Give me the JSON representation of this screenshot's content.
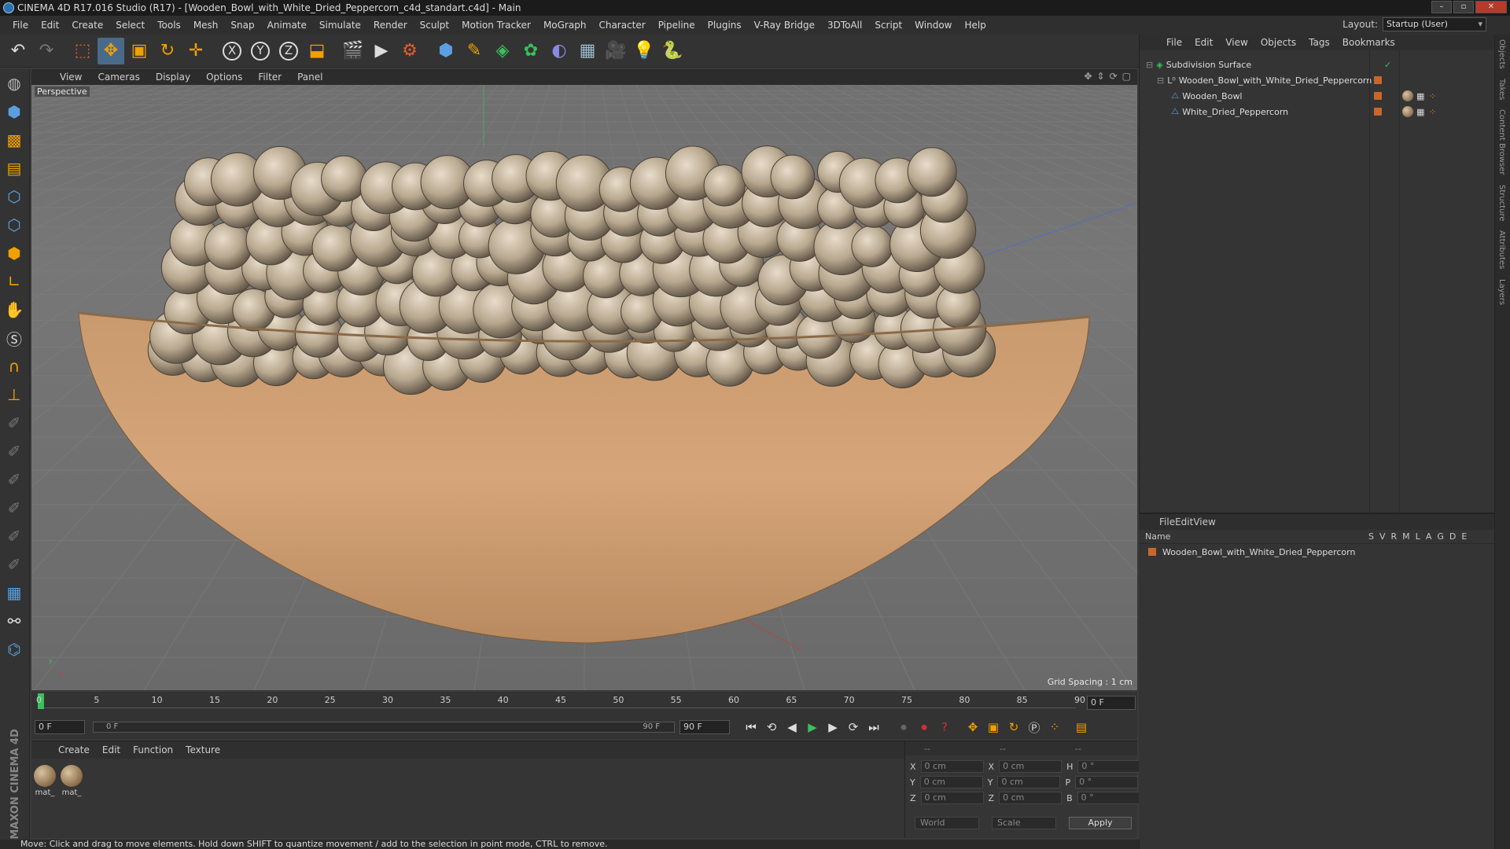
{
  "window": {
    "title": "CINEMA 4D R17.016 Studio (R17) - [Wooden_Bowl_with_White_Dried_Peppercorn_c4d_standart.c4d] - Main"
  },
  "menubar": [
    "File",
    "Edit",
    "Create",
    "Select",
    "Tools",
    "Mesh",
    "Snap",
    "Animate",
    "Simulate",
    "Render",
    "Sculpt",
    "Motion Tracker",
    "MoGraph",
    "Character",
    "Pipeline",
    "Plugins",
    "V-Ray Bridge",
    "3DToAll",
    "Script",
    "Window",
    "Help"
  ],
  "layout": {
    "label": "Layout:",
    "value": "Startup (User)"
  },
  "viewport": {
    "menu": [
      "View",
      "Cameras",
      "Display",
      "Options",
      "Filter",
      "Panel"
    ],
    "camera_label": "Perspective",
    "grid_spacing": "Grid Spacing : 1 cm"
  },
  "timeline": {
    "ticks": [
      "0",
      "5",
      "10",
      "15",
      "20",
      "25",
      "30",
      "35",
      "40",
      "45",
      "50",
      "55",
      "60",
      "65",
      "70",
      "75",
      "80",
      "85",
      "90"
    ],
    "current_frame": "0 F"
  },
  "transport": {
    "start_field": "0 F",
    "range_start": "0 F",
    "range_end": "90 F",
    "end_field": "90 F"
  },
  "materials": {
    "menu": [
      "Create",
      "Edit",
      "Function",
      "Texture"
    ],
    "items": [
      {
        "label": "mat_"
      },
      {
        "label": "mat_"
      }
    ]
  },
  "coords": {
    "headers": [
      "--",
      "--",
      "--"
    ],
    "rows": [
      {
        "axis1": "X",
        "v1": "0 cm",
        "axis2": "X",
        "v2": "0 cm",
        "axis3": "H",
        "v3": "0 °"
      },
      {
        "axis1": "Y",
        "v1": "0 cm",
        "axis2": "Y",
        "v2": "0 cm",
        "axis3": "P",
        "v3": "0 °"
      },
      {
        "axis1": "Z",
        "v1": "0 cm",
        "axis2": "Z",
        "v2": "0 cm",
        "axis3": "B",
        "v3": "0 °"
      }
    ],
    "mode": "World",
    "mode2": "Scale",
    "apply": "Apply"
  },
  "objects": {
    "menu": [
      "File",
      "Edit",
      "View",
      "Objects",
      "Tags",
      "Bookmarks"
    ],
    "tree": [
      {
        "name": "Subdivision Surface"
      },
      {
        "name": "Wooden_Bowl_with_White_Dried_Peppercorn"
      },
      {
        "name": "Wooden_Bowl"
      },
      {
        "name": "White_Dried_Peppercorn"
      }
    ]
  },
  "layers": {
    "menu": [
      "File",
      "Edit",
      "View"
    ],
    "name_header": "Name",
    "flag_headers": [
      "S",
      "V",
      "R",
      "M",
      "L",
      "A",
      "G",
      "D",
      "E"
    ],
    "rows": [
      {
        "name": "Wooden_Bowl_with_White_Dried_Peppercorn"
      }
    ]
  },
  "side_tabs": [
    "Objects",
    "Takes",
    "Content Browser",
    "Structure",
    "Attributes",
    "Layers"
  ],
  "maxon_logo": "MAXON CINEMA 4D",
  "status": "Move: Click and drag to move elements. Hold down SHIFT to quantize movement / add to the selection in point mode, CTRL to remove.",
  "colors": {
    "accent": "#c8672c",
    "selection": "#f0a000"
  }
}
